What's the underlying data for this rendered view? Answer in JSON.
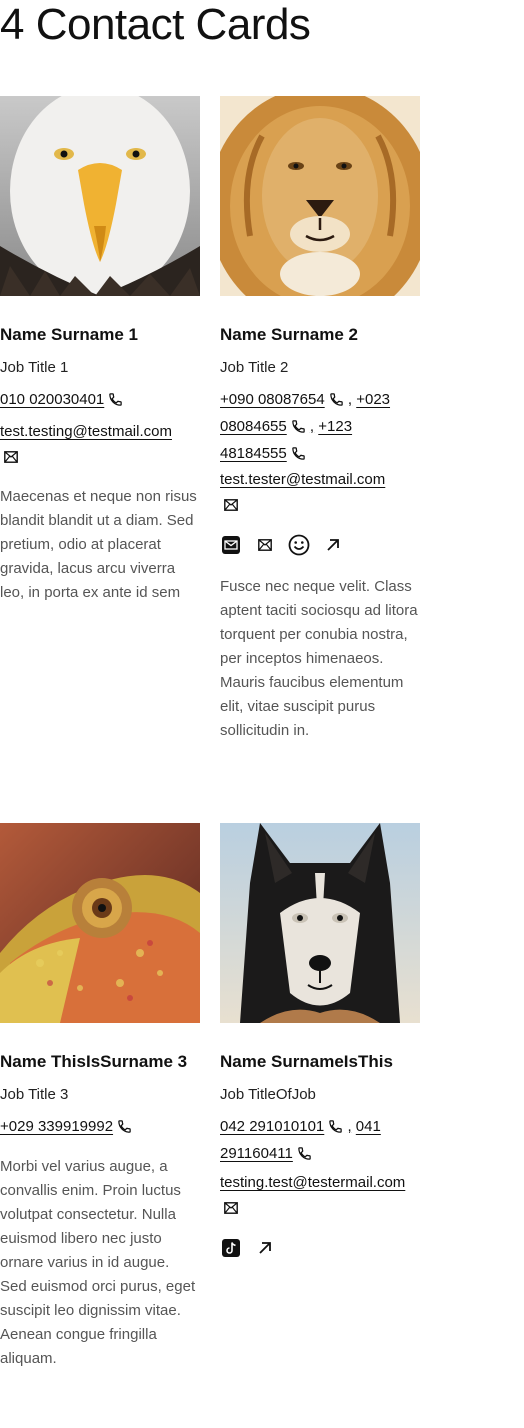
{
  "page": {
    "title": "4 Contact Cards"
  },
  "cards": [
    {
      "name": "Name Surname 1",
      "job": "Job Title 1",
      "phones": [
        "010 020030401"
      ],
      "email": "test.testing@testmail.com",
      "description": "Maecenas et neque non risus blandit blandit ut a diam. Sed pretium, odio at placerat gravida, lacus arcu viverra leo, in porta ex ante id sem"
    },
    {
      "name": "Name Surname 2",
      "job": "Job Title 2",
      "phones": [
        "+090 08087654",
        "+023 08084655",
        "+123 48184555"
      ],
      "email": "test.tester@testmail.com",
      "social": [
        "envelope-solid-icon",
        "envelope-icon",
        "smiley-icon",
        "arrow-up-right-icon"
      ],
      "description": "Fusce nec neque velit. Class aptent taciti sociosqu ad litora torquent per conubia nostra, per inceptos himenaeos. Mauris faucibus elementum elit, vitae suscipit purus sollicitudin in."
    },
    {
      "name": "Name ThisIsSurname 3",
      "job": "Job Title 3",
      "phones": [
        "+029 339919992"
      ],
      "description": "Morbi vel varius augue, a convallis enim. Proin luctus volutpat consectetur. Nulla euismod libero nec justo ornare varius in id augue. Sed euismod orci purus, eget suscipit leo dignissim vitae. Aenean congue fringilla aliquam."
    },
    {
      "name": "Name SurnameIsThis",
      "job": "Job TitleOfJob",
      "phones": [
        "042 291010101",
        "041 291160411"
      ],
      "email": "testing.test@testermail.com",
      "social": [
        "tiktok-icon",
        "arrow-up-right-icon"
      ]
    }
  ],
  "separator": ","
}
